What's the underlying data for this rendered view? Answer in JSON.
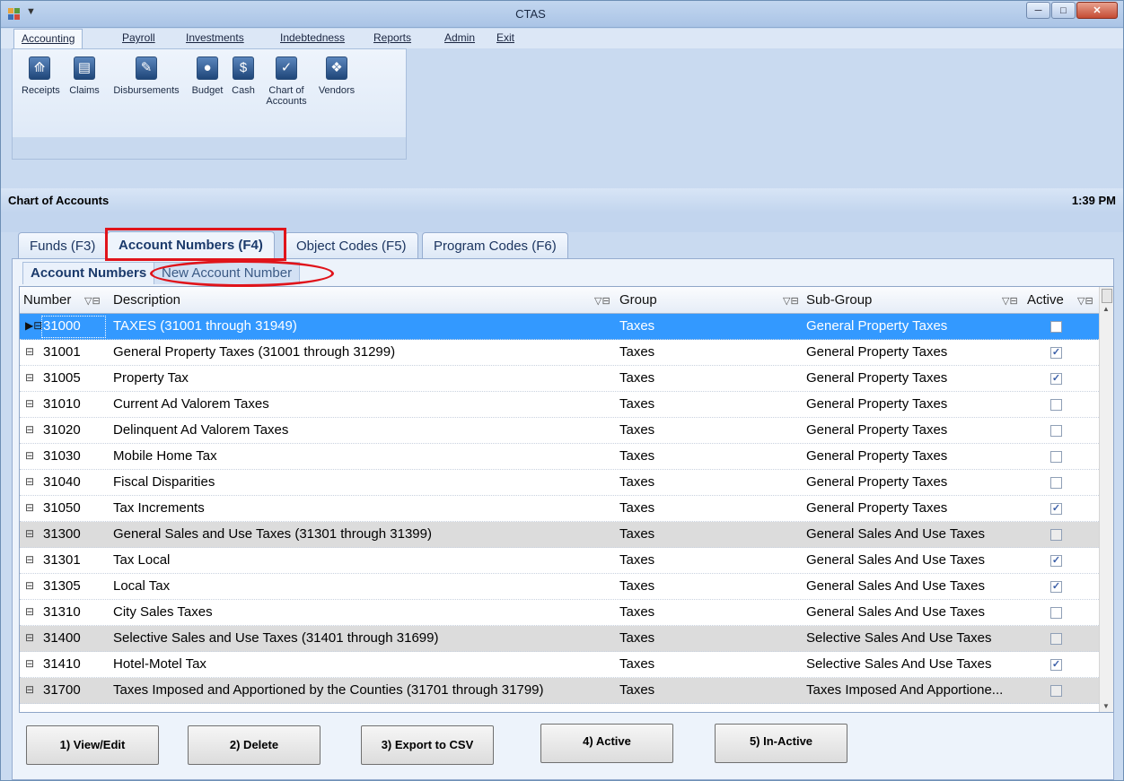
{
  "window": {
    "title": "CTAS"
  },
  "menu": [
    "Accounting",
    "Payroll",
    "Investments",
    "Indebtedness",
    "Reports",
    "Admin",
    "Exit"
  ],
  "ribbon": {
    "receipts": "Receipts",
    "claims": "Claims",
    "disbursements": "Disbursements",
    "budget": "Budget",
    "cash": "Cash",
    "chart_l1": "Chart of",
    "chart_l2": "Accounts",
    "vendors": "Vendors"
  },
  "banner": {
    "title": "Chart of Accounts",
    "time": "1:39 PM"
  },
  "tabs": [
    "Funds (F3)",
    "Account Numbers (F4)",
    "Object Codes (F5)",
    "Program Codes (F6)"
  ],
  "subtabs": [
    "Account Numbers",
    "New Account Number"
  ],
  "grid": {
    "headers": [
      "Number",
      "Description",
      "Group",
      "Sub-Group",
      "Active"
    ],
    "rows": [
      {
        "number": "31000",
        "description": "TAXES (31001 through 31949)",
        "group": "Taxes",
        "subgroup": "General Property Taxes",
        "active": false,
        "style": "selected"
      },
      {
        "number": "31001",
        "description": "General Property Taxes (31001 through 31299)",
        "group": "Taxes",
        "subgroup": "General Property Taxes",
        "active": true,
        "style": "normal"
      },
      {
        "number": "31005",
        "description": "Property Tax",
        "group": "Taxes",
        "subgroup": "General Property Taxes",
        "active": true,
        "style": "normal"
      },
      {
        "number": "31010",
        "description": "Current Ad Valorem Taxes",
        "group": "Taxes",
        "subgroup": "General Property Taxes",
        "active": false,
        "style": "normal"
      },
      {
        "number": "31020",
        "description": "Delinquent Ad Valorem Taxes",
        "group": "Taxes",
        "subgroup": "General Property Taxes",
        "active": false,
        "style": "normal"
      },
      {
        "number": "31030",
        "description": "Mobile Home Tax",
        "group": "Taxes",
        "subgroup": "General Property Taxes",
        "active": false,
        "style": "normal"
      },
      {
        "number": "31040",
        "description": "Fiscal Disparities",
        "group": "Taxes",
        "subgroup": "General Property Taxes",
        "active": false,
        "style": "normal"
      },
      {
        "number": "31050",
        "description": "Tax Increments",
        "group": "Taxes",
        "subgroup": "General Property Taxes",
        "active": true,
        "style": "normal"
      },
      {
        "number": "31300",
        "description": "General Sales and Use Taxes (31301 through 31399)",
        "group": "Taxes",
        "subgroup": "General Sales And Use Taxes",
        "active": false,
        "style": "grey"
      },
      {
        "number": "31301",
        "description": "Tax Local",
        "group": "Taxes",
        "subgroup": "General Sales And Use Taxes",
        "active": true,
        "style": "normal"
      },
      {
        "number": "31305",
        "description": "Local Tax",
        "group": "Taxes",
        "subgroup": "General Sales And Use Taxes",
        "active": true,
        "style": "normal"
      },
      {
        "number": "31310",
        "description": "City Sales Taxes",
        "group": "Taxes",
        "subgroup": "General Sales And Use Taxes",
        "active": false,
        "style": "normal"
      },
      {
        "number": "31400",
        "description": "Selective Sales and Use Taxes (31401 through 31699)",
        "group": "Taxes",
        "subgroup": "Selective Sales And Use Taxes",
        "active": false,
        "style": "grey"
      },
      {
        "number": "31410",
        "description": "Hotel-Motel Tax",
        "group": "Taxes",
        "subgroup": "Selective Sales And Use Taxes",
        "active": true,
        "style": "normal"
      },
      {
        "number": "31700",
        "description": "Taxes Imposed and Apportioned by the Counties (31701 through 31799)",
        "group": "Taxes",
        "subgroup": "Taxes Imposed And Apportione...",
        "active": false,
        "style": "grey"
      }
    ]
  },
  "buttons": [
    "1) View/Edit",
    "2) Delete",
    "3) Export to CSV",
    "4) Active",
    "5) In-Active"
  ]
}
